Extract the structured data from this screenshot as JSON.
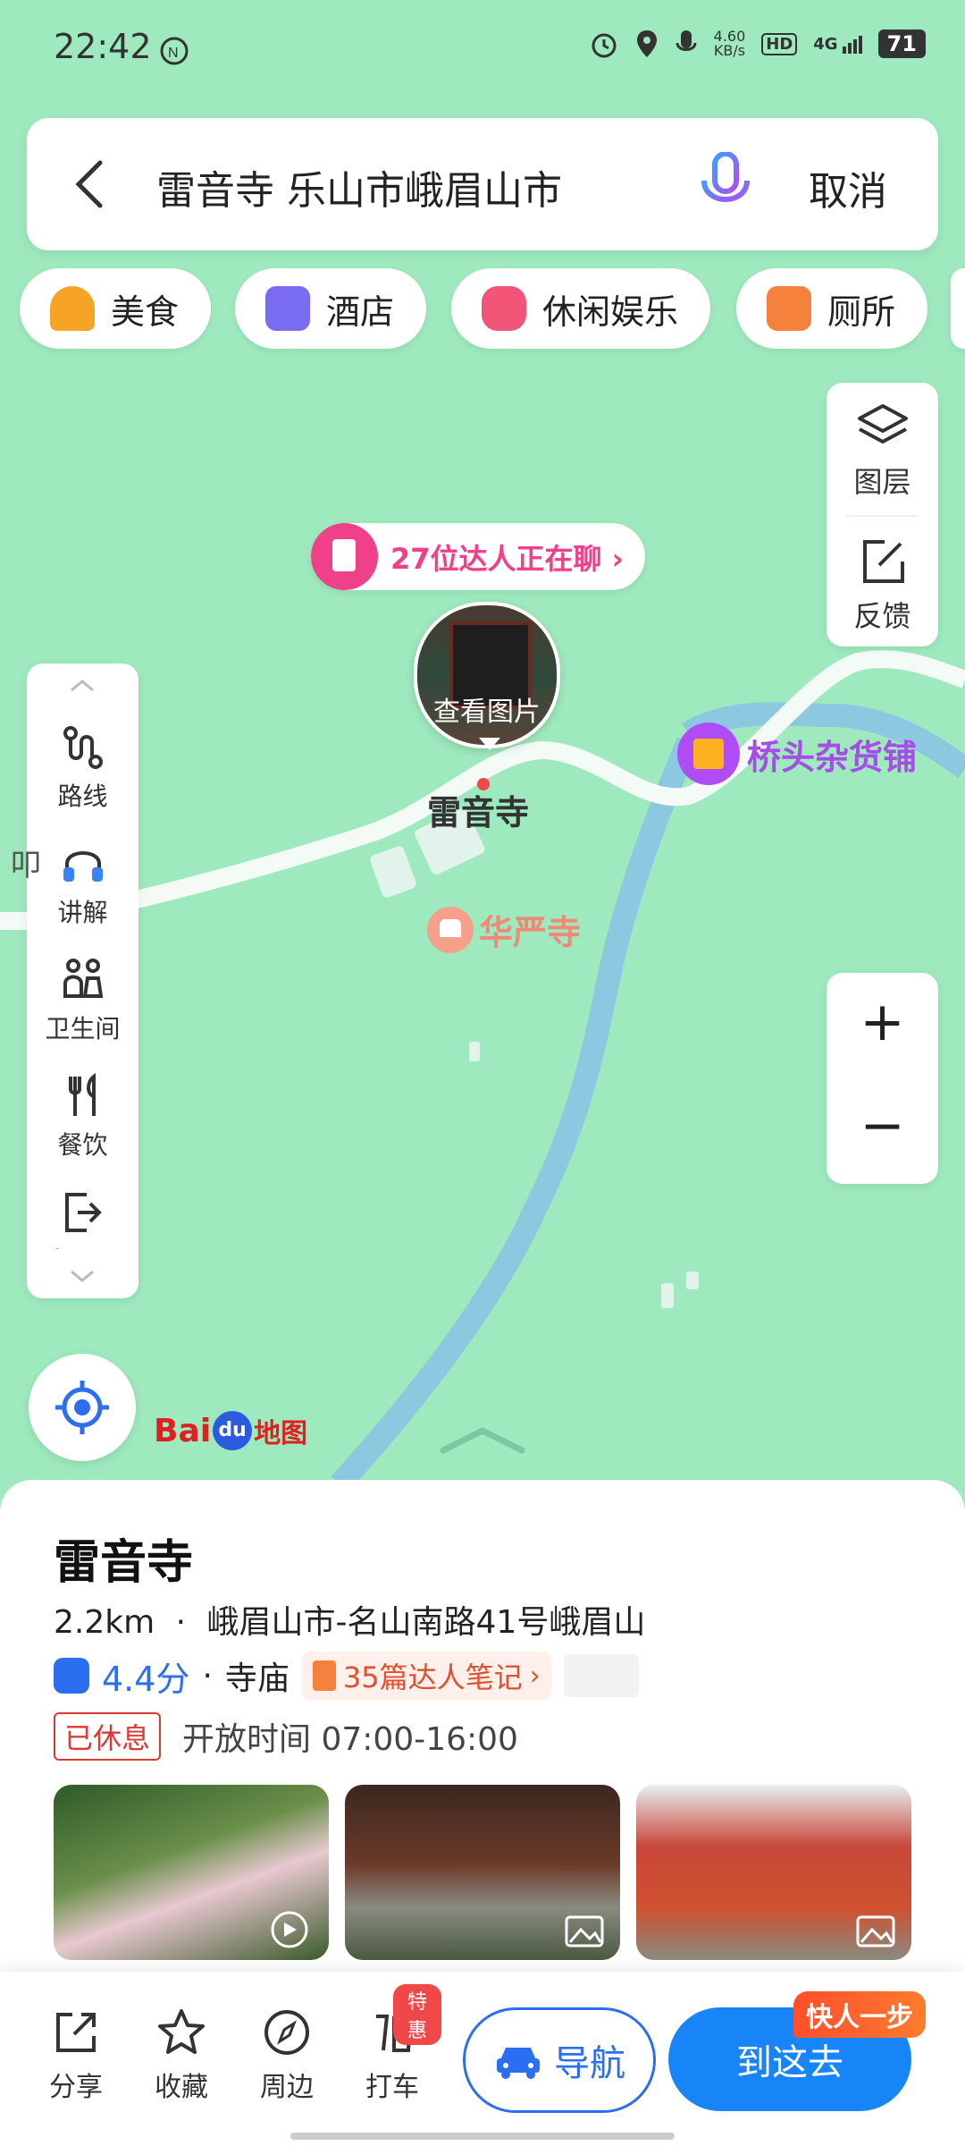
{
  "status": {
    "time": "22:42",
    "speed_value": "4.60",
    "speed_unit": "KB/s",
    "hd": "HD",
    "network": "4G",
    "battery": "71"
  },
  "search": {
    "query": "雷音寺 乐山市峨眉山市",
    "cancel": "取消"
  },
  "chips": [
    {
      "label": "美食",
      "icon": "food-icon",
      "color": "#f7a326"
    },
    {
      "label": "酒店",
      "icon": "hotel-icon",
      "color": "#7a6cf0"
    },
    {
      "label": "休闲娱乐",
      "icon": "gamepad-icon",
      "color": "#f25577"
    },
    {
      "label": "厕所",
      "icon": "toilet-icon",
      "color": "#f5813c"
    }
  ],
  "map_controls": {
    "layers": "图层",
    "feedback": "反馈",
    "zoom_in": "+",
    "zoom_out": "−"
  },
  "left_tools": [
    {
      "label": "路线",
      "icon": "route-icon"
    },
    {
      "label": "讲解",
      "icon": "headphones-icon"
    },
    {
      "label": "卫生间",
      "icon": "restroom-icon"
    },
    {
      "label": "餐饮",
      "icon": "fork-knife-icon"
    },
    {
      "label": "出入口",
      "icon": "exit-icon"
    }
  ],
  "map": {
    "chat_bubble": "27位达人正在聊 ›",
    "view_photo": "查看图片",
    "poi_main": "雷音寺",
    "poi_shop": "桥头杂货铺",
    "poi_temple": "华严寺",
    "edge_label": "叩",
    "logo_text": "Bai",
    "logo_du": "du",
    "logo_map": "地图"
  },
  "place": {
    "name": "雷音寺",
    "distance": "2.2km",
    "address": "峨眉山市-名山南路41号峨眉山",
    "rating": "4.4分",
    "category": "寺庙",
    "notes": "35篇达人笔记",
    "status": "已休息",
    "hours": "开放时间 07:00-16:00"
  },
  "actions": {
    "share": "分享",
    "collect": "收藏",
    "nearby": "周边",
    "taxi": "打车",
    "taxi_badge": "特惠",
    "navigate": "导航",
    "go": "到这去",
    "promo": "快人一步"
  },
  "colors": {
    "map_bg": "#9ee9bd",
    "river": "#8cc8e0",
    "accent_blue": "#2c6ef0",
    "pink": "#f0408a",
    "closed_red": "#e03636"
  }
}
